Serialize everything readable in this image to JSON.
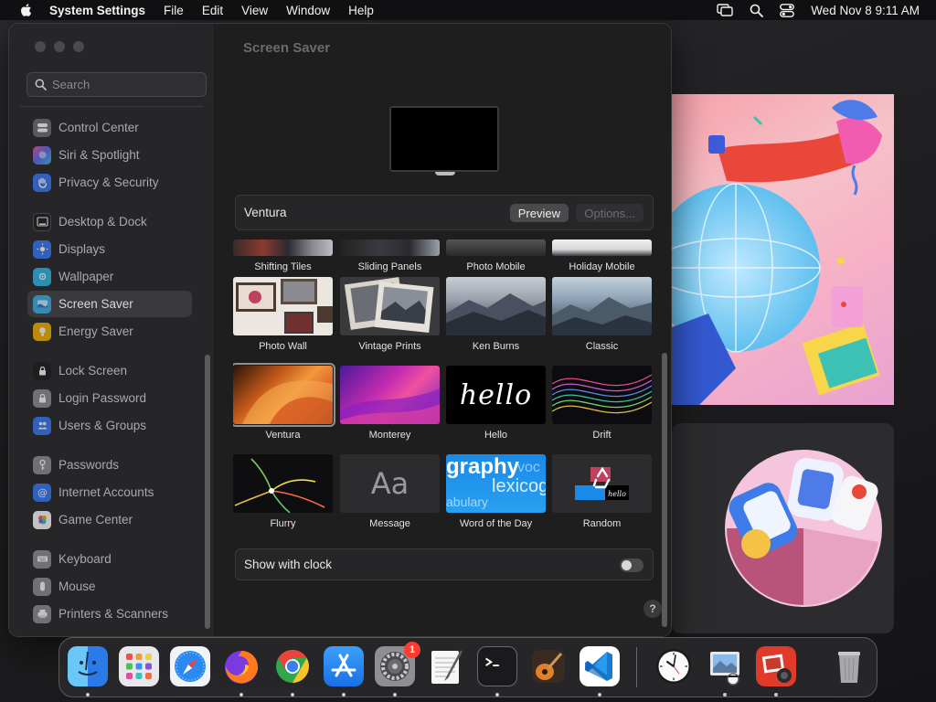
{
  "menubar": {
    "app_name": "System Settings",
    "menus": [
      "File",
      "Edit",
      "View",
      "Window",
      "Help"
    ],
    "datetime": "Wed Nov 8  9:11 AM"
  },
  "sidebar": {
    "search_placeholder": "Search",
    "items": [
      {
        "label": "Control Center",
        "icon": "control-center-icon",
        "color": "#6e6e73"
      },
      {
        "label": "Siri & Spotlight",
        "icon": "siri-icon",
        "color": "#a23ed0"
      },
      {
        "label": "Privacy & Security",
        "icon": "hand-icon",
        "color": "#3478f6"
      },
      {
        "label": "Desktop & Dock",
        "icon": "dock-icon",
        "color": "#1c1c1e"
      },
      {
        "label": "Displays",
        "icon": "sun-icon",
        "color": "#3478f6"
      },
      {
        "label": "Wallpaper",
        "icon": "wallpaper-icon",
        "color": "#2fb8e8"
      },
      {
        "label": "Screen Saver",
        "icon": "screen-saver-icon",
        "color": "#36a8e0"
      },
      {
        "label": "Energy Saver",
        "icon": "bulb-icon",
        "color": "#f5b400"
      },
      {
        "label": "Lock Screen",
        "icon": "lock-icon",
        "color": "#1c1c1e"
      },
      {
        "label": "Login Password",
        "icon": "login-password-icon",
        "color": "#8e8e93"
      },
      {
        "label": "Users & Groups",
        "icon": "users-icon",
        "color": "#3478f6"
      },
      {
        "label": "Passwords",
        "icon": "key-icon",
        "color": "#8e8e93"
      },
      {
        "label": "Internet Accounts",
        "icon": "at-icon",
        "color": "#3478f6"
      },
      {
        "label": "Game Center",
        "icon": "game-center-icon",
        "color": "#e05a9c"
      },
      {
        "label": "Keyboard",
        "icon": "keyboard-icon",
        "color": "#8e8e93"
      },
      {
        "label": "Mouse",
        "icon": "mouse-icon",
        "color": "#8e8e93"
      },
      {
        "label": "Printers & Scanners",
        "icon": "printer-icon",
        "color": "#8e8e93"
      }
    ]
  },
  "main": {
    "title": "Screen Saver",
    "current_saver": "Ventura",
    "preview_label": "Preview",
    "options_label": "Options...",
    "partial_savers": [
      "Shifting Tiles",
      "Sliding Panels",
      "Photo Mobile",
      "Holiday Mobile"
    ],
    "savers": [
      "Photo Wall",
      "Vintage Prints",
      "Ken Burns",
      "Classic",
      "Ventura",
      "Monterey",
      "Hello",
      "Drift",
      "Flurry",
      "Message",
      "Word of the Day",
      "Random"
    ],
    "selected_saver": "Ventura",
    "hello_text": "hello",
    "message_text": "Aa",
    "word_text_1": "graphy",
    "word_text_2": "lexicog",
    "word_text_3": "abulary",
    "word_text_4": "voc",
    "show_with_clock_label": "Show with clock",
    "show_with_clock": false,
    "help_label": "?"
  },
  "dock": {
    "apps": [
      {
        "name": "Finder",
        "running": true
      },
      {
        "name": "Launchpad",
        "running": false
      },
      {
        "name": "Safari",
        "running": false
      },
      {
        "name": "Firefox",
        "running": true
      },
      {
        "name": "Chrome",
        "running": true
      },
      {
        "name": "App Store",
        "running": true
      },
      {
        "name": "System Settings",
        "running": true,
        "badge": "1"
      },
      {
        "name": "TextEdit",
        "running": false
      },
      {
        "name": "Terminal",
        "running": true
      },
      {
        "name": "GarageBand",
        "running": false
      },
      {
        "name": "Visual Studio Code",
        "running": true
      },
      {
        "name": "Clock",
        "running": false
      },
      {
        "name": "Preview",
        "running": true
      },
      {
        "name": "Photo Booth",
        "running": true
      },
      {
        "name": "Trash",
        "running": false
      }
    ]
  }
}
